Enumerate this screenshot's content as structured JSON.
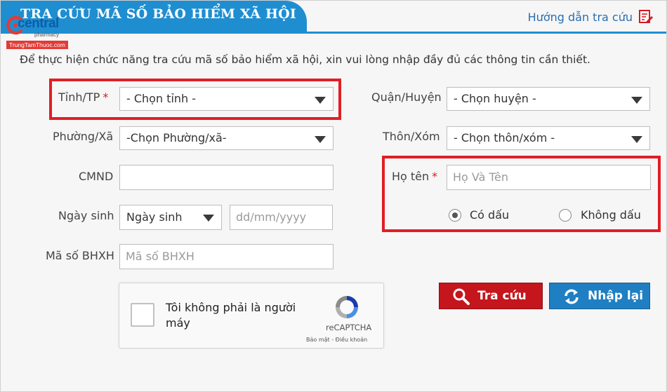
{
  "header": {
    "title": "TRA CỨU MÃ SỐ BẢO HIỂM XÃ HỘI",
    "guide_link": "Hướng dẫn tra cứu",
    "accent_color": "#1f8ed1"
  },
  "watermark": {
    "brand": "central",
    "sub": "pharmacy",
    "site": "TrungTamThuoc.com"
  },
  "intro": "Để thực hiện chức năng tra cứu mã số bảo hiểm xã hội, xin vui lòng nhập đầy đủ các thông tin cần thiết.",
  "form": {
    "province": {
      "label": "Tỉnh/TP",
      "required_mark": "*",
      "value": "- Chọn tỉnh -"
    },
    "district": {
      "label": "Quận/Huyện",
      "value": "- Chọn huyện -"
    },
    "ward": {
      "label": "Phường/Xã",
      "value": "-Chọn Phường/xã-"
    },
    "village": {
      "label": "Thôn/Xóm",
      "value": "- Chọn thôn/xóm -"
    },
    "id_card": {
      "label": "CMND",
      "value": "",
      "placeholder": ""
    },
    "full_name": {
      "label": "Họ tên",
      "required_mark": "*",
      "placeholder": "Họ Và Tên"
    },
    "accent_option": {
      "options": [
        "Có dấu",
        "Không dấu"
      ],
      "selected": "Có dấu"
    },
    "birth_date": {
      "label": "Ngày sinh",
      "type_value": "Ngày sinh",
      "placeholder": "dd/mm/yyyy"
    },
    "bhxh_code": {
      "label": "Mã số BHXH",
      "placeholder": "Mã số BHXH"
    }
  },
  "captcha": {
    "checkbox_text": "Tôi không phải là người máy",
    "brand": "reCAPTCHA",
    "links": "Bảo mật - Điều khoản"
  },
  "buttons": {
    "search": "Tra cứu",
    "reset": "Nhập lại",
    "search_color": "#c4161c",
    "reset_color": "#1f7fc2"
  },
  "highlight_color": "#e11e25"
}
